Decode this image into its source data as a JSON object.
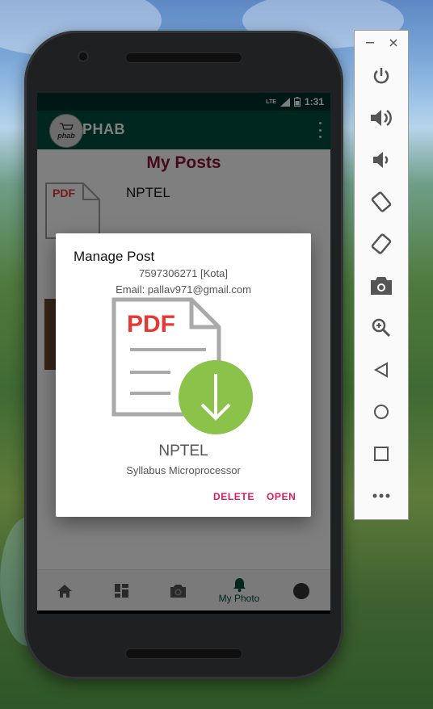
{
  "status_bar": {
    "network": "LTE",
    "time": "1:31"
  },
  "app_bar": {
    "title": "PHAB",
    "logo_text": "phab"
  },
  "page": {
    "title": "My Posts",
    "post": {
      "name": "NPTEL",
      "thumb_label": "PDF"
    }
  },
  "dialog": {
    "title": "Manage Post",
    "phone": "7597306271 [Kota]",
    "email": "Email: pallav971@gmail.com",
    "pdf_label": "PDF",
    "doc_name": "NPTEL",
    "doc_desc": "Syllabus Microprocessor",
    "delete_label": "DELETE",
    "open_label": "OPEN"
  },
  "bottom_nav": {
    "items": [
      {
        "icon": "home-icon",
        "label": ""
      },
      {
        "icon": "dashboard-icon",
        "label": ""
      },
      {
        "icon": "camera-icon",
        "label": ""
      },
      {
        "icon": "bell-icon",
        "label": "My Photo"
      },
      {
        "icon": "profile-icon",
        "label": ""
      }
    ],
    "active_color": "#004d40"
  },
  "emulator_panel": {
    "controls": [
      "power-icon",
      "volume-up-icon",
      "volume-down-icon",
      "rotate-left-icon",
      "rotate-right-icon",
      "screenshot-icon",
      "zoom-icon",
      "back-icon",
      "home-icon",
      "overview-icon",
      "more-icon"
    ]
  },
  "colors": {
    "app_bar": "#004d40",
    "status_bar": "#00312b",
    "title": "#8b1538",
    "accent": "#d81b60",
    "download_badge": "#8bc34a",
    "pdf_red": "#e53935"
  }
}
